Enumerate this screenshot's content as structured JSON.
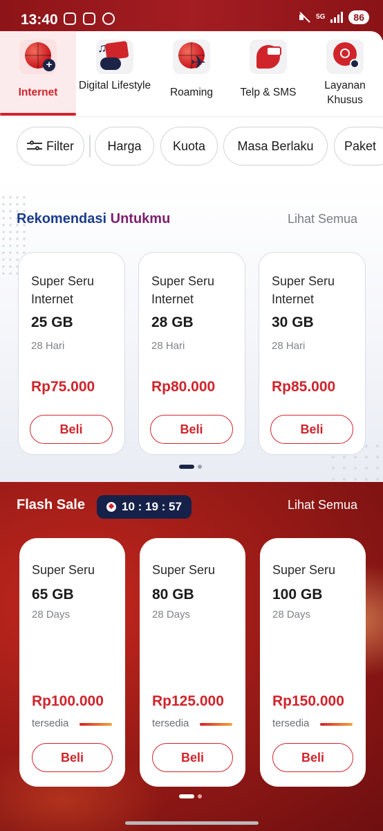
{
  "status_bar": {
    "time": "13:40",
    "network": "5G",
    "battery": "86"
  },
  "categories": [
    {
      "label": "Internet",
      "icon": "internet-plus-icon",
      "active": true
    },
    {
      "label": "Digital Lifestyle",
      "icon": "digital-lifestyle-icon",
      "active": false
    },
    {
      "label": "Roaming",
      "icon": "roaming-plane-icon",
      "active": false
    },
    {
      "label": "Telp & SMS",
      "icon": "phone-sms-icon",
      "active": false
    },
    {
      "label": "Layanan Khusus",
      "icon": "special-service-icon",
      "active": false
    }
  ],
  "filters": {
    "filter_label": "Filter",
    "chips": [
      "Harga",
      "Kuota",
      "Masa Berlaku",
      "Paket"
    ]
  },
  "recommendation": {
    "title_part1": "Rekomendasi",
    "title_part2": "Untukmu",
    "see_all": "Lihat Semua",
    "cards": [
      {
        "name": "Super Seru Internet",
        "quota": "25 GB",
        "validity": "28 Hari",
        "price": "Rp75.000",
        "buy": "Beli"
      },
      {
        "name": "Super Seru Internet",
        "quota": "28 GB",
        "validity": "28 Hari",
        "price": "Rp80.000",
        "buy": "Beli"
      },
      {
        "name": "Super Seru Internet",
        "quota": "30 GB",
        "validity": "28 Hari",
        "price": "Rp85.000",
        "buy": "Beli"
      }
    ],
    "page_index": 1,
    "page_count": 2
  },
  "flash_sale": {
    "title": "Flash Sale",
    "timer": "10 : 19 : 57",
    "see_all": "Lihat Semua",
    "cards": [
      {
        "name": "Super Seru",
        "quota": "65 GB",
        "validity": "28 Days",
        "price": "Rp100.000",
        "availability_label": "tersedia",
        "availability_fraction": 1.0,
        "buy": "Beli"
      },
      {
        "name": "Super Seru",
        "quota": "80 GB",
        "validity": "28 Days",
        "price": "Rp125.000",
        "availability_label": "tersedia",
        "availability_fraction": 1.0,
        "buy": "Beli"
      },
      {
        "name": "Super Seru",
        "quota": "100 GB",
        "validity": "28 Days",
        "price": "Rp150.000",
        "availability_label": "tersedia",
        "availability_fraction": 1.0,
        "buy": "Beli"
      }
    ],
    "page_index": 1,
    "page_count": 2
  },
  "colors": {
    "brand_red": "#d0242b",
    "navy": "#16214a",
    "reco_blue": "#1b3c8c",
    "reco_purple": "#7c1e6e"
  }
}
